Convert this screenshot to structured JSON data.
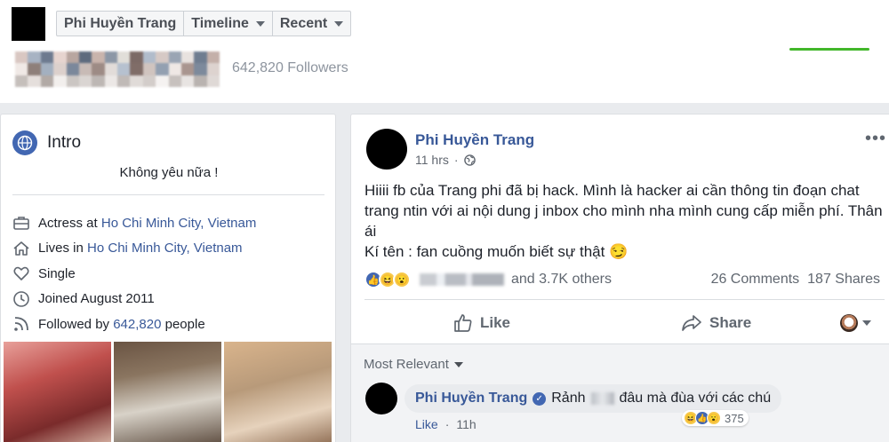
{
  "header": {
    "breadcrumb": [
      "Phi Huyền Trang",
      "Timeline",
      "Recent"
    ],
    "followers": "642,820 Followers",
    "pixel_colors": [
      "#d9c7c2",
      "#a7b3c3",
      "#6d7a8f",
      "#e6d4cf",
      "#b8a6a0",
      "#5e6b7e",
      "#c9b4ac",
      "#8c97a6",
      "#e1ded9",
      "#7c6a66",
      "#b1bccb",
      "#d6c9c5",
      "#9aa5b4",
      "#e8e2df",
      "#6f7d90",
      "#c4b0a9",
      "#f0e9e6",
      "#8e7f7a",
      "#a3b0c0",
      "#dcd0cc",
      "#7b889b",
      "#c8bbb6",
      "#9d8b85",
      "#e2dcd9",
      "#b6c1cf",
      "#806d68",
      "#d0c4bf",
      "#93a0b1",
      "#efe8e5",
      "#a9958f",
      "#7d8a9c",
      "#ddd3cf",
      "#c5bfbb",
      "#e5dfdc",
      "#b2aaa6",
      "#f2efed",
      "#cbc6c3",
      "#dad5d2",
      "#bdb7b4",
      "#ece8e6",
      "#c0bab7",
      "#e0dbd8",
      "#d3cdca",
      "#f5f2f1",
      "#c7c1be",
      "#e8e4e2",
      "#b9b3b0",
      "#dfd9d6"
    ]
  },
  "intro": {
    "title": "Intro",
    "bio": "Không yêu nữa !",
    "rows": [
      {
        "icon": "briefcase-icon",
        "prefix": "Actress at ",
        "link": "Ho Chi Minh City, Vietnam",
        "suffix": ""
      },
      {
        "icon": "home-icon",
        "prefix": "Lives in ",
        "link": "Ho Chi Minh City, Vietnam",
        "suffix": ""
      },
      {
        "icon": "heart-icon",
        "prefix": "Single",
        "link": "",
        "suffix": ""
      },
      {
        "icon": "clock-icon",
        "prefix": "Joined August 2011",
        "link": "",
        "suffix": ""
      },
      {
        "icon": "rss-icon",
        "prefix": "Followed by ",
        "link": "642,820",
        "suffix": " people"
      }
    ],
    "photo_colors": [
      "#c0504d",
      "#8a7560",
      "#b89a7a"
    ]
  },
  "post": {
    "author": "Phi Huyền Trang",
    "time": "11 hrs",
    "more": "•••",
    "lines": [
      "Hiiii fb của Trang phi đã bị hack. Mình là hacker ai cần thông tin đoạn chat",
      "trang ntin với ai nội dung j inbox cho mình nha mình cung cấp miễn phí. Thân",
      "ái",
      "Kí tên : fan cuồng muốn biết sự thật 😏"
    ],
    "reaction_icons": [
      "👍",
      "😆",
      "😮"
    ],
    "reactions_text": "and 3.7K others",
    "comments_count": "26 Comments",
    "shares_count": "187 Shares",
    "like_label": "Like",
    "share_label": "Share"
  },
  "comments": {
    "sort_label": "Most Relevant",
    "items": [
      {
        "author": "Phi Huyền Trang",
        "text_before": "Rảnh",
        "text_after": "đâu mà đùa với các chú",
        "reaction_icons": [
          "😆",
          "👍",
          "😮"
        ],
        "reaction_count": "375",
        "like_label": "Like",
        "dot": "·",
        "time": "11h"
      }
    ]
  },
  "colors": {
    "link": "#385898",
    "brand": "#4267b2",
    "green": "#42b72a"
  }
}
